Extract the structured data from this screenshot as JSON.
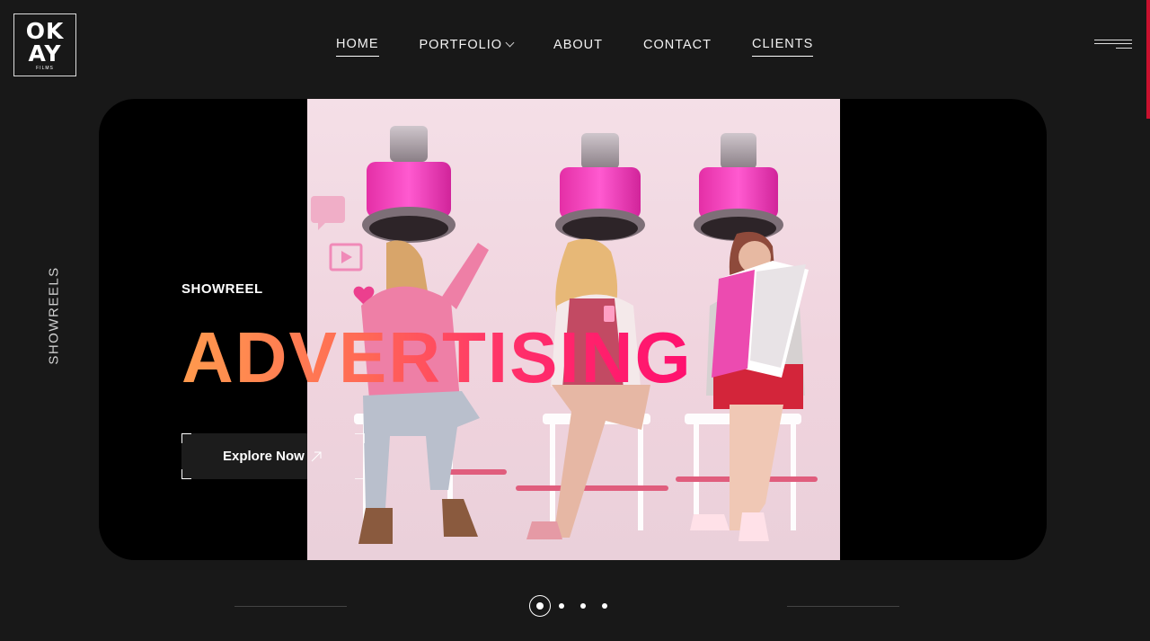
{
  "brand": {
    "logo_line1": "OK",
    "logo_line2": "AY",
    "logo_sub": "FILMS"
  },
  "nav": {
    "items": [
      {
        "label": "HOME",
        "active": true
      },
      {
        "label": "PORTFOLIO",
        "has_dropdown": true
      },
      {
        "label": "ABOUT"
      },
      {
        "label": "CONTACT"
      },
      {
        "label": "CLIENTS",
        "active": true
      }
    ]
  },
  "side": {
    "label": "SHOWREELS"
  },
  "hero": {
    "kicker": "SHOWREEL",
    "headline": "ADVERTISING",
    "cta_label": "Explore Now",
    "image_icon": "photo-three-women-under-pink-hair-dryers"
  },
  "slider": {
    "total": 4,
    "active_index": 0
  },
  "colors": {
    "background": "#181818",
    "hero_bg": "#000000",
    "headline_gradient_start": "#ff9a4d",
    "headline_gradient_end": "#ff0f6f",
    "accent_red": "#c8102e",
    "pink": "#ff3fb4"
  }
}
